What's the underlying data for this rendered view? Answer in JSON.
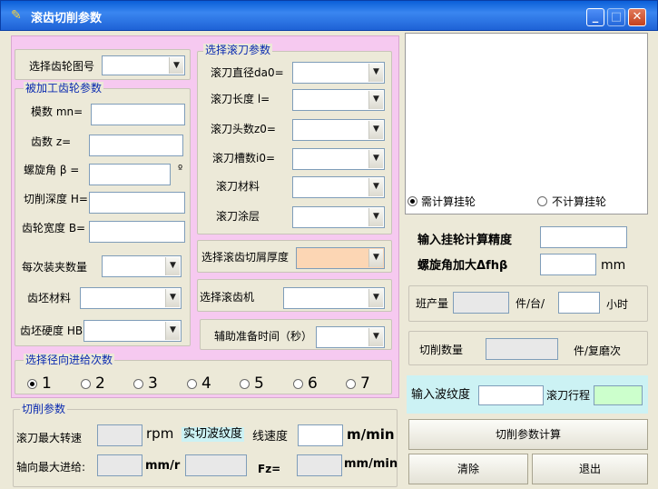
{
  "window": {
    "title": "滚齿切削参数",
    "minimize": "_",
    "maximize": "□",
    "close": "✕"
  },
  "gear_select": {
    "label": "选择齿轮图号"
  },
  "workpiece": {
    "title": "被加工齿轮参数",
    "module_label": "模数 mn=",
    "teeth_label": "齿数  z=",
    "helix_label": "螺旋角 β =",
    "helix_unit": "º",
    "depth_label": "切削深度 H=",
    "width_label": "齿轮宽度 B=",
    "clamp_label": "每次装夹数量",
    "material_label": "齿坯材料",
    "hardness_label": "齿坯硬度 HB"
  },
  "hob": {
    "title": "选择滚刀参数",
    "diameter_label": "滚刀直径da0=",
    "length_label": "滚刀长度  l=",
    "heads_label": "滚刀头数z0=",
    "slots_label": "滚刀槽数i0=",
    "material_label": "滚刀材料",
    "coating_label": "滚刀涂层"
  },
  "chip_label": "选择滚齿切屑厚度",
  "machine_label": "选择滚齿机",
  "prep_label": "辅助准备时间（秒）",
  "radial": {
    "title": "选择径向进给次数",
    "options": [
      "1",
      "2",
      "3",
      "4",
      "5",
      "6",
      "7"
    ],
    "selected": "1"
  },
  "cutting": {
    "title": "切削参数",
    "max_speed_label": "滚刀最大转速",
    "rpm_unit": "rpm",
    "wave_label": "实切波纹度",
    "line_speed_label": "线速度",
    "mmin_unit": "m/min",
    "axial_label": "轴向最大进给:",
    "mmr_unit": "mm/r",
    "fz_label": "Fz=",
    "mmmin_unit": "mm/min"
  },
  "change_gear": {
    "need_label": "需计算挂轮",
    "no_need_label": "不计算挂轮",
    "selected": "need",
    "precision_label": "输入挂轮计算精度",
    "helix_add_label": "螺旋角加大Δfhβ",
    "mm_unit": "mm"
  },
  "production": {
    "label": "班产量",
    "unit": "件/台/",
    "hour_unit": "小时"
  },
  "cut_count": {
    "label": "切削数量",
    "unit": "件/复磨次"
  },
  "wave_input_label": "输入波纹度",
  "hob_travel_label": "滚刀行程",
  "buttons": {
    "calc": "切削参数计算",
    "clear": "清除",
    "exit": "退出"
  }
}
